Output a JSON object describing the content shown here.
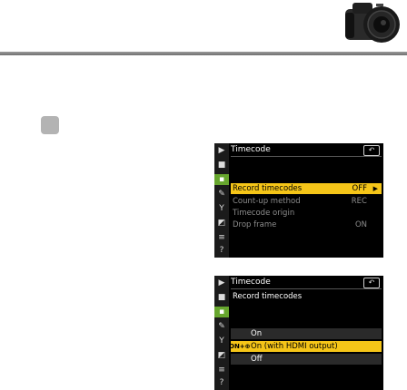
{
  "screens": [
    {
      "title": "Timecode",
      "back_icon": "back-arrow-icon",
      "items": [
        {
          "label": "Record timecodes",
          "value": "OFF",
          "selected": true
        },
        {
          "label": "Count-up method",
          "value": "REC",
          "selected": false
        },
        {
          "label": "Timecode origin",
          "value": "",
          "selected": false
        },
        {
          "label": "Drop frame",
          "value": "ON",
          "selected": false
        }
      ]
    },
    {
      "title": "Timecode",
      "subtitle": "Record timecodes",
      "options": [
        {
          "label": "On",
          "selected": false
        },
        {
          "label": "On (with HDMI output)",
          "selected": true,
          "badge": "ON+⊕"
        },
        {
          "label": "Off",
          "selected": false
        }
      ]
    }
  ],
  "colors": {
    "highlight": "#f5c518",
    "active_tab": "#67a62e",
    "screen_bg": "#000000",
    "rule": "#8a8a8a"
  }
}
